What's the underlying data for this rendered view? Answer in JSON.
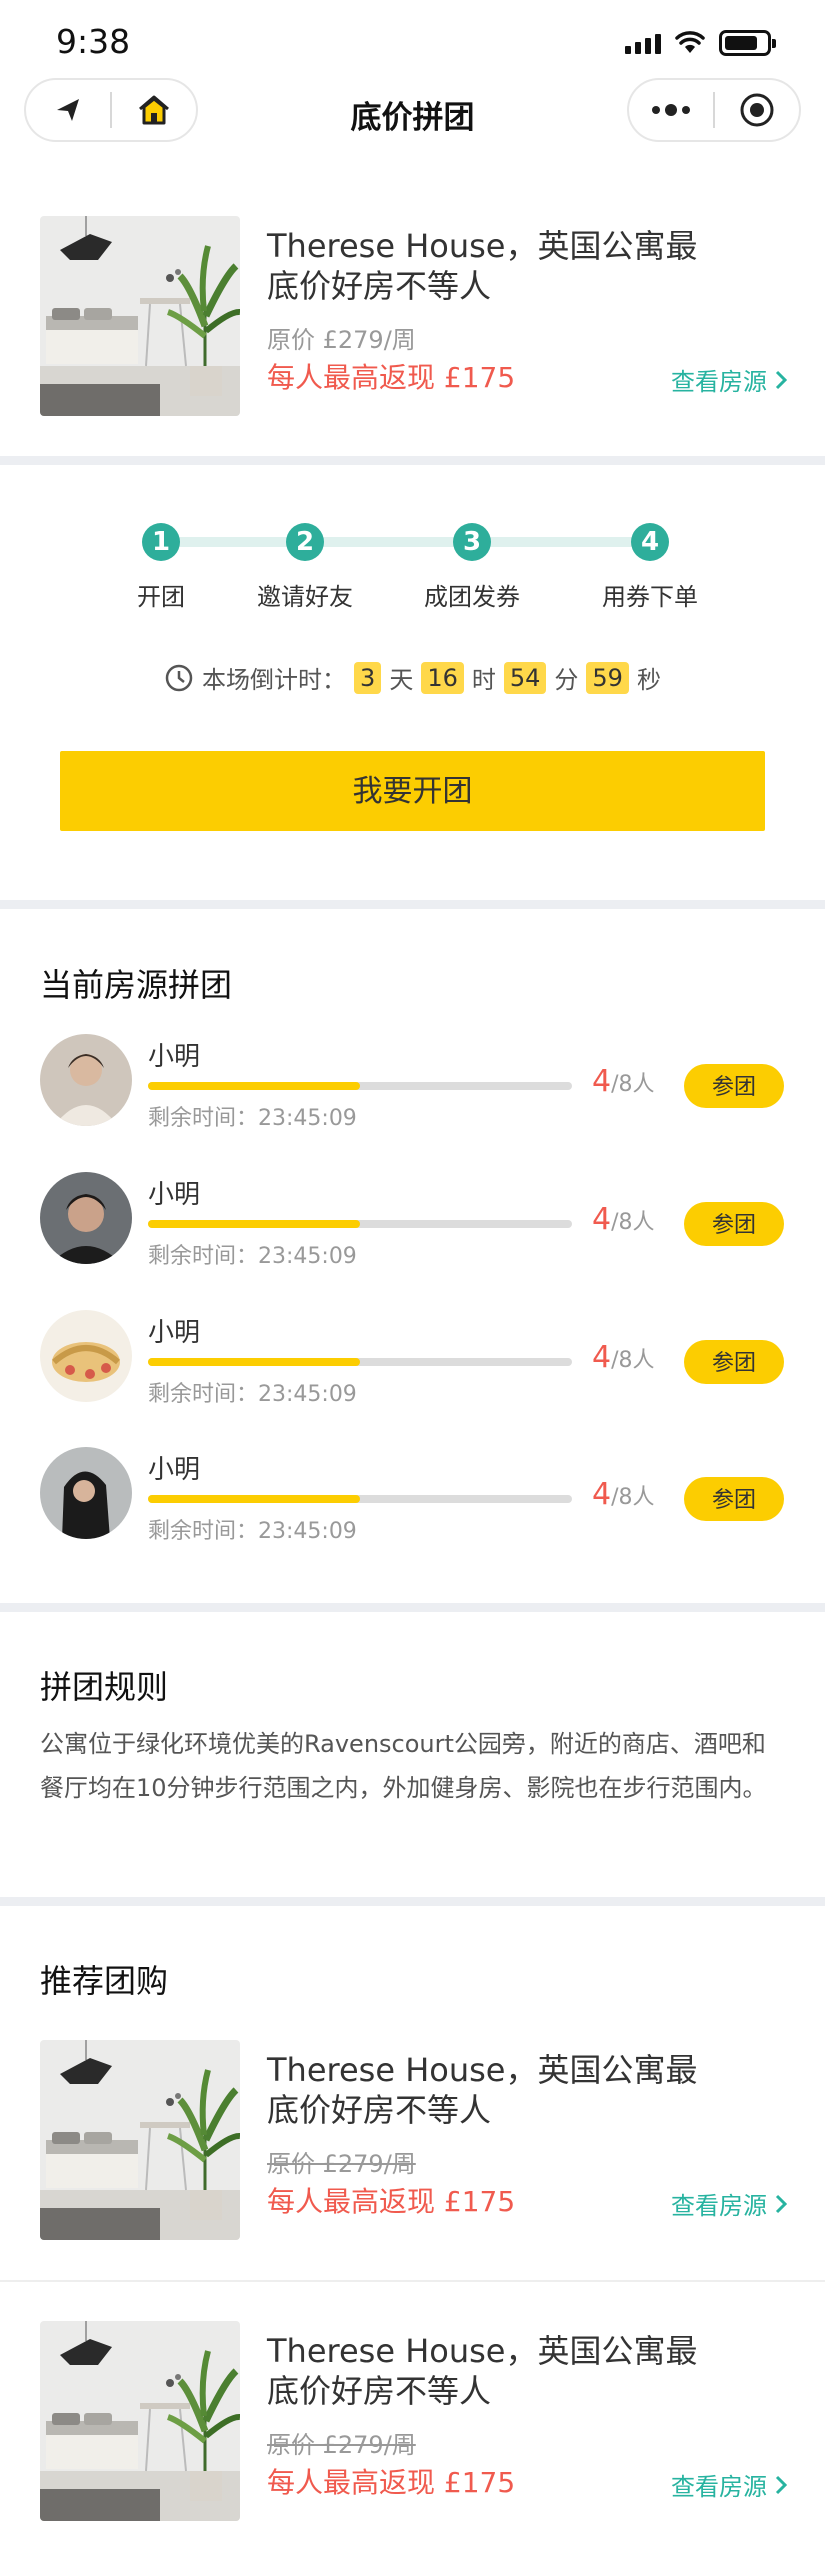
{
  "status_bar": {
    "time": "9:38"
  },
  "nav": {
    "title": "底价拼团"
  },
  "product_top": {
    "title": "Therese House，英国公寓最底价好房不等人",
    "original_price": "原价 £279/周",
    "rebate": "每人最高返现 £175",
    "link": "查看房源"
  },
  "steps": [
    {
      "num": "1",
      "label": "开团"
    },
    {
      "num": "2",
      "label": "邀请好友"
    },
    {
      "num": "3",
      "label": "成团发券"
    },
    {
      "num": "4",
      "label": "用券下单"
    }
  ],
  "countdown": {
    "label": "本场倒计时：",
    "days": "3",
    "day_unit": "天",
    "hours": "16",
    "hour_unit": "时",
    "minutes": "54",
    "minute_unit": "分",
    "seconds": "59",
    "second_unit": "秒"
  },
  "start_button": "我要开团",
  "current_groups": {
    "title": "当前房源拼团",
    "items": [
      {
        "name": "小明",
        "remaining": "剩余时间：23:45:09",
        "joined": "4",
        "total": "/8人",
        "progress": 0.5,
        "join_label": "参团"
      },
      {
        "name": "小明",
        "remaining": "剩余时间：23:45:09",
        "joined": "4",
        "total": "/8人",
        "progress": 0.5,
        "join_label": "参团"
      },
      {
        "name": "小明",
        "remaining": "剩余时间：23:45:09",
        "joined": "4",
        "total": "/8人",
        "progress": 0.5,
        "join_label": "参团"
      },
      {
        "name": "小明",
        "remaining": "剩余时间：23:45:09",
        "joined": "4",
        "total": "/8人",
        "progress": 0.5,
        "join_label": "参团"
      }
    ]
  },
  "rules": {
    "title": "拼团规则",
    "text": "公寓位于绿化环境优美的Ravenscourt公园旁，附近的商店、酒吧和餐厅均在10分钟步行范围之内，外加健身房、影院也在步行范围内。"
  },
  "recommend": {
    "title": "推荐团购",
    "items": [
      {
        "title": "Therese House，英国公寓最底价好房不等人",
        "original_price": "原价 £279/周",
        "rebate": "每人最高返现 £175",
        "link": "查看房源"
      },
      {
        "title": "Therese House，英国公寓最底价好房不等人",
        "original_price": "原价 £279/周",
        "rebate": "每人最高返现 £175",
        "link": "查看房源"
      }
    ]
  },
  "colors": {
    "accent_yellow": "#fccd01",
    "teal": "#2eae9b",
    "red": "#f05a4e"
  }
}
